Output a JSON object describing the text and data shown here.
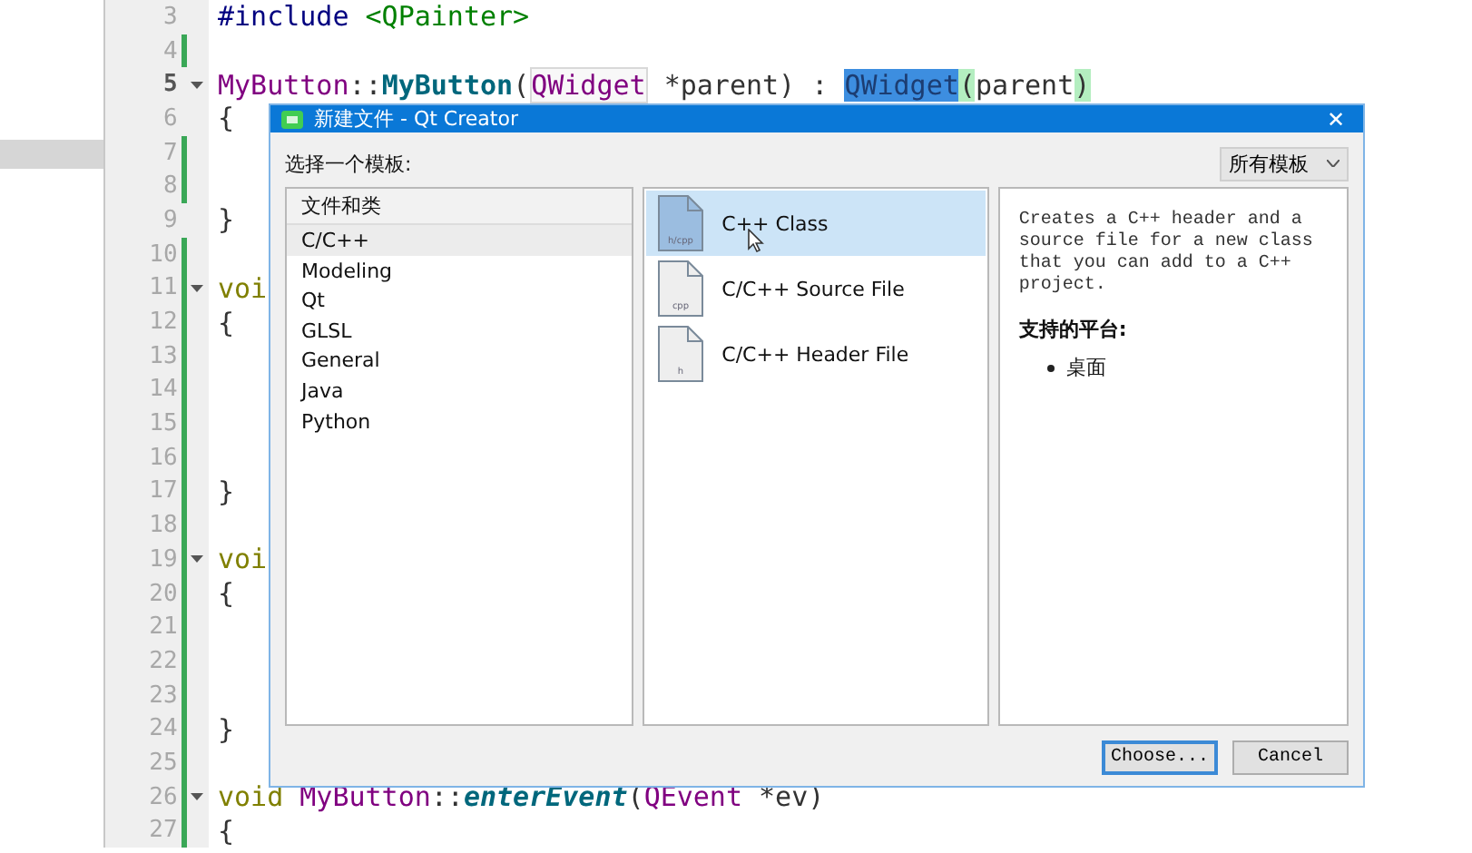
{
  "editor": {
    "lines": [
      {
        "number": "3",
        "modified": false,
        "current": false,
        "foldable": false,
        "tokens": [
          {
            "kind": "preproc",
            "text": "#include "
          },
          {
            "kind": "string",
            "text": "<QPainter>"
          }
        ]
      },
      {
        "number": "4",
        "modified": true,
        "current": false,
        "foldable": false
      },
      {
        "number": "5",
        "modified": false,
        "current": true,
        "foldable": true,
        "tokens": [
          {
            "kind": "class",
            "text": "MyButton"
          },
          {
            "kind": "plain",
            "text": "::"
          },
          {
            "kind": "func",
            "text": "MyButton"
          },
          {
            "kind": "plain",
            "text": "("
          },
          {
            "kind": "type-boxed",
            "text": "QWidget"
          },
          {
            "kind": "plain",
            "text": " *parent) : "
          },
          {
            "kind": "selected",
            "text": "QWidget"
          },
          {
            "kind": "paren-match",
            "text": "("
          },
          {
            "kind": "plain",
            "text": "parent"
          },
          {
            "kind": "paren-match",
            "text": ")"
          }
        ]
      },
      {
        "number": "6",
        "modified": false,
        "current": false,
        "foldable": false,
        "tokens": [
          {
            "kind": "plain",
            "text": "{"
          }
        ]
      },
      {
        "number": "7",
        "modified": true,
        "current": false,
        "foldable": false
      },
      {
        "number": "8",
        "modified": true,
        "current": false,
        "foldable": false
      },
      {
        "number": "9",
        "modified": false,
        "current": false,
        "foldable": false,
        "tokens": [
          {
            "kind": "plain",
            "text": "}"
          }
        ]
      },
      {
        "number": "10",
        "modified": true,
        "current": false,
        "foldable": false
      },
      {
        "number": "11",
        "modified": true,
        "current": false,
        "foldable": true,
        "tokens": [
          {
            "kind": "keyword",
            "text": "voi"
          }
        ]
      },
      {
        "number": "12",
        "modified": true,
        "current": false,
        "foldable": false,
        "tokens": [
          {
            "kind": "plain",
            "text": "{"
          }
        ]
      },
      {
        "number": "13",
        "modified": true,
        "current": false,
        "foldable": false
      },
      {
        "number": "14",
        "modified": true,
        "current": false,
        "foldable": false
      },
      {
        "number": "15",
        "modified": true,
        "current": false,
        "foldable": false
      },
      {
        "number": "16",
        "modified": true,
        "current": false,
        "foldable": false
      },
      {
        "number": "17",
        "modified": true,
        "current": false,
        "foldable": false,
        "tokens": [
          {
            "kind": "plain",
            "text": "}"
          }
        ]
      },
      {
        "number": "18",
        "modified": true,
        "current": false,
        "foldable": false
      },
      {
        "number": "19",
        "modified": true,
        "current": false,
        "foldable": true,
        "tokens": [
          {
            "kind": "keyword",
            "text": "voi"
          }
        ]
      },
      {
        "number": "20",
        "modified": true,
        "current": false,
        "foldable": false,
        "tokens": [
          {
            "kind": "plain",
            "text": "{"
          }
        ]
      },
      {
        "number": "21",
        "modified": true,
        "current": false,
        "foldable": false
      },
      {
        "number": "22",
        "modified": true,
        "current": false,
        "foldable": false
      },
      {
        "number": "23",
        "modified": true,
        "current": false,
        "foldable": false
      },
      {
        "number": "24",
        "modified": true,
        "current": false,
        "foldable": false,
        "tokens": [
          {
            "kind": "plain",
            "text": "}"
          }
        ]
      },
      {
        "number": "25",
        "modified": true,
        "current": false,
        "foldable": false
      },
      {
        "number": "26",
        "modified": true,
        "current": false,
        "foldable": true,
        "tokens": [
          {
            "kind": "keyword",
            "text": "void "
          },
          {
            "kind": "class",
            "text": "MyButton"
          },
          {
            "kind": "plain",
            "text": "::"
          },
          {
            "kind": "func-italic",
            "text": "enterEvent"
          },
          {
            "kind": "plain",
            "text": "("
          },
          {
            "kind": "type",
            "text": "QEvent"
          },
          {
            "kind": "plain",
            "text": " *ev)"
          }
        ]
      },
      {
        "number": "27",
        "modified": true,
        "current": false,
        "foldable": false,
        "tokens": [
          {
            "kind": "plain",
            "text": "{"
          }
        ]
      }
    ]
  },
  "dialog": {
    "title": "新建文件 - Qt Creator",
    "close": "✕",
    "prompt": "选择一个模板:",
    "filter": "所有模板",
    "categories": {
      "header": "文件和类",
      "items": [
        {
          "label": "C/C++",
          "selected": true
        },
        {
          "label": "Modeling",
          "selected": false
        },
        {
          "label": "Qt",
          "selected": false
        },
        {
          "label": "GLSL",
          "selected": false
        },
        {
          "label": "General",
          "selected": false
        },
        {
          "label": "Java",
          "selected": false
        },
        {
          "label": "Python",
          "selected": false
        }
      ]
    },
    "templates": [
      {
        "label": "C++ Class",
        "icon_label": "h/cpp",
        "selected": true
      },
      {
        "label": "C/C++ Source File",
        "icon_label": "cpp",
        "selected": false
      },
      {
        "label": "C/C++ Header File",
        "icon_label": "h",
        "selected": false
      }
    ],
    "description": {
      "text": "Creates a C++ header and a source file for a new class that you can add to a C++ project.",
      "platforms_heading": "支持的平台:",
      "platforms": [
        "桌面"
      ]
    },
    "buttons": [
      {
        "label": "Choose...",
        "default": true
      },
      {
        "label": "Cancel",
        "default": false
      }
    ]
  }
}
